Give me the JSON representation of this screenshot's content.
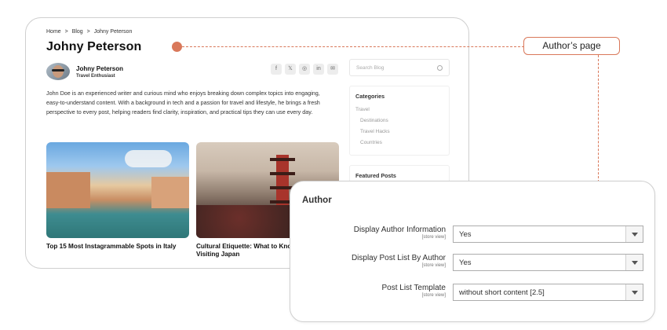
{
  "blog": {
    "breadcrumb": [
      "Home",
      ">",
      "Blog",
      ">",
      "Johny Peterson"
    ],
    "title": "Johny Peterson",
    "author": {
      "name": "Johny Peterson",
      "role": "Travel Enthusiast"
    },
    "social_icons": [
      "facebook-icon",
      "x-icon",
      "instagram-icon",
      "linkedin-icon",
      "email-icon"
    ],
    "bio": "John Doe is an experienced writer and curious mind who enjoys breaking down complex topics into engaging, easy-to-understand content. With a background in tech and a passion for travel and lifestyle, he brings a fresh perspective to every post, helping readers find clarity, inspiration, and practical tips they can use every day.",
    "posts": [
      {
        "title": "Top 15 Most Instagrammable Spots in Italy"
      },
      {
        "title": "Cultural Etiquette: What to Know Before Visiting Japan"
      }
    ],
    "sidebar": {
      "search_placeholder": "Search Blog",
      "categories_heading": "Categories",
      "categories": [
        {
          "label": "Travel",
          "level": 0
        },
        {
          "label": "Destinations",
          "level": 1
        },
        {
          "label": "Travel Hacks",
          "level": 1
        },
        {
          "label": "Countries",
          "level": 1
        }
      ],
      "featured_heading": "Featured Posts"
    }
  },
  "callout": {
    "label": "Author’s page"
  },
  "admin": {
    "title": "Author",
    "settings": [
      {
        "label": "Display Author Information",
        "scope": "[store view]",
        "value": "Yes"
      },
      {
        "label": "Display Post List By Author",
        "scope": "[store view]",
        "value": "Yes"
      },
      {
        "label": "Post List Template",
        "scope": "[store view]",
        "value": "without short content [2.5]"
      }
    ]
  },
  "colors": {
    "accent": "#d9785a",
    "border": "#cfcfcf"
  }
}
